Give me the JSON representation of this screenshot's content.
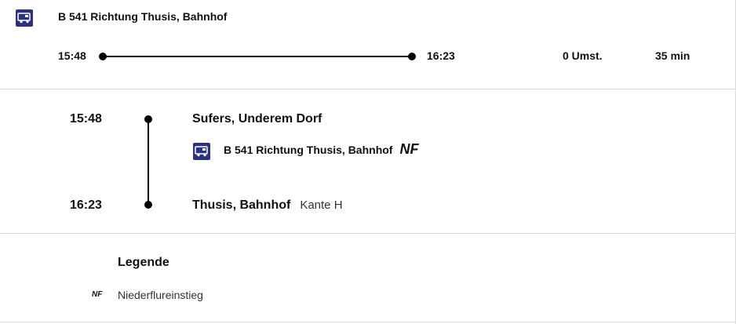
{
  "summary": {
    "line_title": "B 541 Richtung Thusis, Bahnhof",
    "dep_time": "15:48",
    "arr_time": "16:23",
    "transfers": "0 Umst.",
    "duration": "35 min"
  },
  "details": {
    "dep_time": "15:48",
    "dep_stop": "Sufers, Underem Dorf",
    "line_label": "B 541 Richtung Thusis, Bahnhof",
    "line_attr": "NF",
    "arr_time": "16:23",
    "arr_stop": "Thusis, Bahnhof",
    "arr_platform": "Kante H"
  },
  "legend": {
    "title": "Legende",
    "items": [
      {
        "code": "NF",
        "text": "Niederflureinstieg"
      }
    ]
  },
  "colors": {
    "bus_icon": "#2d327d",
    "divider": "#d8d8d8"
  },
  "icons": [
    "bus-icon"
  ]
}
